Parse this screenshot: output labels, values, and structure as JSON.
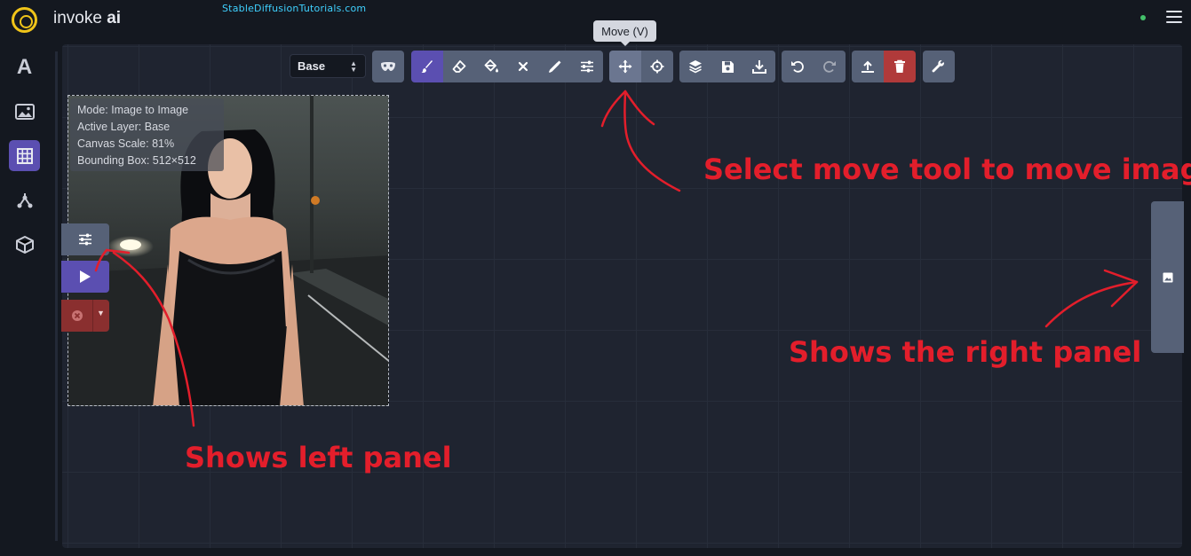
{
  "app": {
    "brand_light": "invoke",
    "brand_bold": "ai",
    "watermark": "StableDiffusionTutorials.com"
  },
  "sidebar": {
    "items": [
      {
        "icon": "text-to-image-icon",
        "label": "A"
      },
      {
        "icon": "image-icon"
      },
      {
        "icon": "canvas-grid-icon",
        "active": true
      },
      {
        "icon": "node-graph-icon"
      },
      {
        "icon": "model-box-icon"
      }
    ]
  },
  "toolbar": {
    "layer_value": "Base",
    "tooltip": "Move (V)"
  },
  "canvas_info": {
    "mode": "Mode: Image to Image",
    "active_layer": "Active Layer: Base",
    "canvas_scale": "Canvas Scale: 81%",
    "bounding_box": "Bounding Box: 512×512"
  },
  "annotations": {
    "move_tool": "Select move tool to move image",
    "right_panel": "Shows the right panel",
    "left_panel": "Shows left panel"
  },
  "colors": {
    "accent": "#5b4fb1",
    "button": "#566177",
    "danger": "#b03a3a",
    "annotation": "#e31e2b",
    "logo": "#f0c419"
  }
}
